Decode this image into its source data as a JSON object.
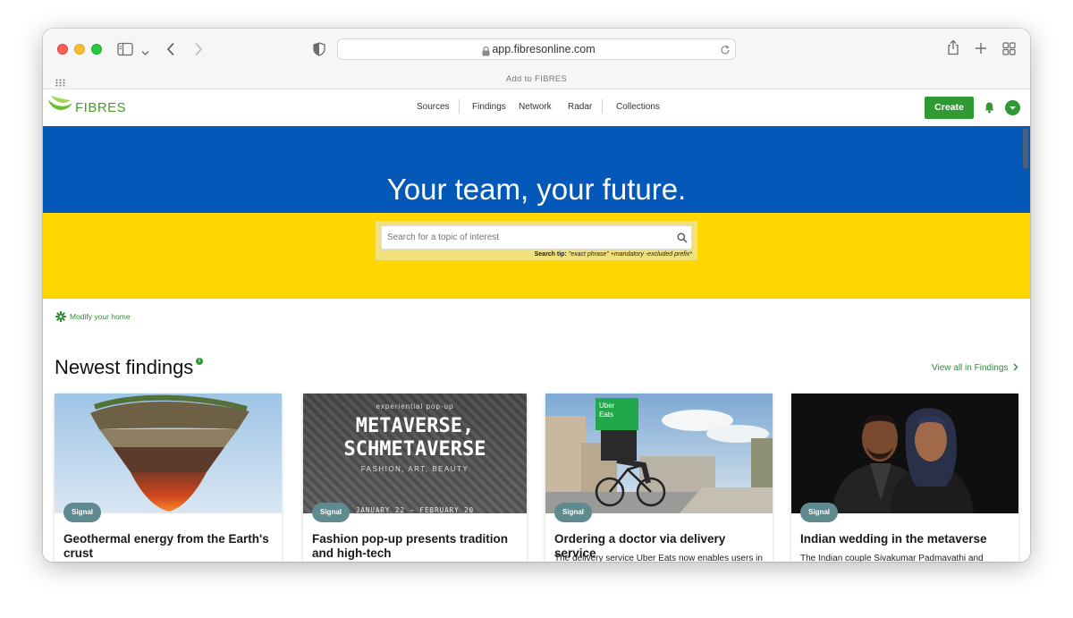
{
  "browser": {
    "url": "app.fibresonline.com",
    "bookmark_bar_text": "Add to FIBRES"
  },
  "app": {
    "logo_text": "FIBRES",
    "nav": [
      "Sources",
      "Findings",
      "Network",
      "Radar",
      "Collections"
    ],
    "create_label": "Create",
    "colors": {
      "accent": "#2f9a34",
      "hero_blue": "#0458b7",
      "hero_yellow": "#ffd700"
    }
  },
  "hero": {
    "title": "Your team, your future.",
    "search_placeholder": "Search for a topic of interest",
    "tip_label": "Search tip:",
    "tip_text": "\"exact phrase\" +mandatory -excluded prefix*"
  },
  "modify_home": "Modify your home",
  "findings": {
    "title": "Newest findings",
    "info_marker": "i",
    "view_all": "View all in Findings",
    "cards": [
      {
        "badge": "Signal",
        "title": "Geothermal energy from the Earth's crust",
        "desc": ""
      },
      {
        "badge": "Signal",
        "title": "Fashion pop-up presents tradition and high-tech",
        "desc": "",
        "image_text": {
          "top": "experiential pop-up",
          "headline1": "METAVERSE,",
          "headline2": "SCHMETAVERSE",
          "subtitle": "FASHION, ART, BEAUTY",
          "dates": "JANUARY 22 – FEBRUARY 20"
        }
      },
      {
        "badge": "Signal",
        "title": "Ordering a doctor via delivery service",
        "desc": "The delivery service Uber Eats now enables users in",
        "image_text": {
          "bag_line1": "Uber",
          "bag_line2": "Eats"
        }
      },
      {
        "badge": "Signal",
        "title": "Indian wedding in the metaverse",
        "desc": "The Indian couple Sivakumar Padmavathi and"
      }
    ]
  }
}
